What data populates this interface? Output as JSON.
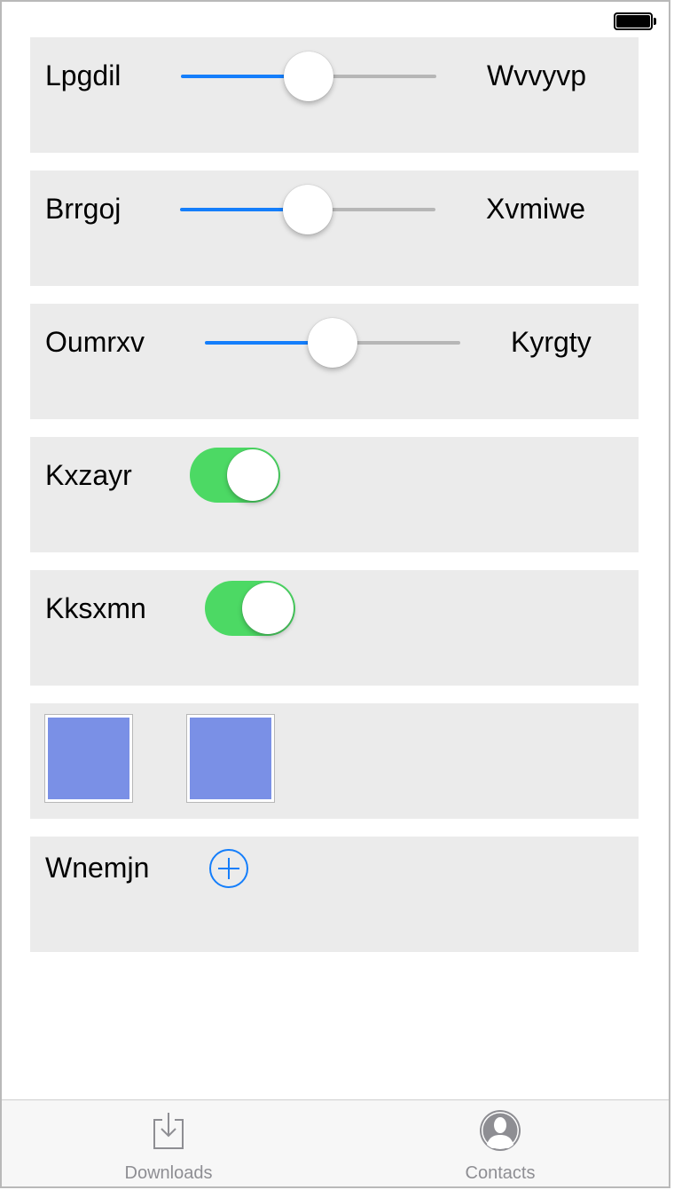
{
  "status_bar": {
    "battery_icon": "battery-full-icon"
  },
  "rows": [
    {
      "type": "slider",
      "min_label": "Lpgdil",
      "max_label": "Wvvyvp",
      "value": 0.5
    },
    {
      "type": "slider",
      "min_label": "Brrgoj",
      "max_label": "Xvmiwe",
      "value": 0.5
    },
    {
      "type": "slider",
      "min_label": "Oumrxv",
      "max_label": "Kyrgty",
      "value": 0.5
    },
    {
      "type": "toggle",
      "label": "Kxzayr",
      "on": true
    },
    {
      "type": "toggle",
      "label": "Kksxmn",
      "on": true
    },
    {
      "type": "swatches",
      "count": 2,
      "color": "#7a90e6"
    },
    {
      "type": "add",
      "label": "Wnemjn",
      "icon": "plus-circle-icon"
    }
  ],
  "tabbar": {
    "items": [
      {
        "label": "Downloads",
        "icon": "download-tray-icon"
      },
      {
        "label": "Contacts",
        "icon": "person-circle-icon"
      }
    ]
  },
  "colors": {
    "accent": "#147efb",
    "toggle_on": "#4cd964",
    "card_bg": "#ebebeb",
    "tab_label": "#8e8e93"
  }
}
